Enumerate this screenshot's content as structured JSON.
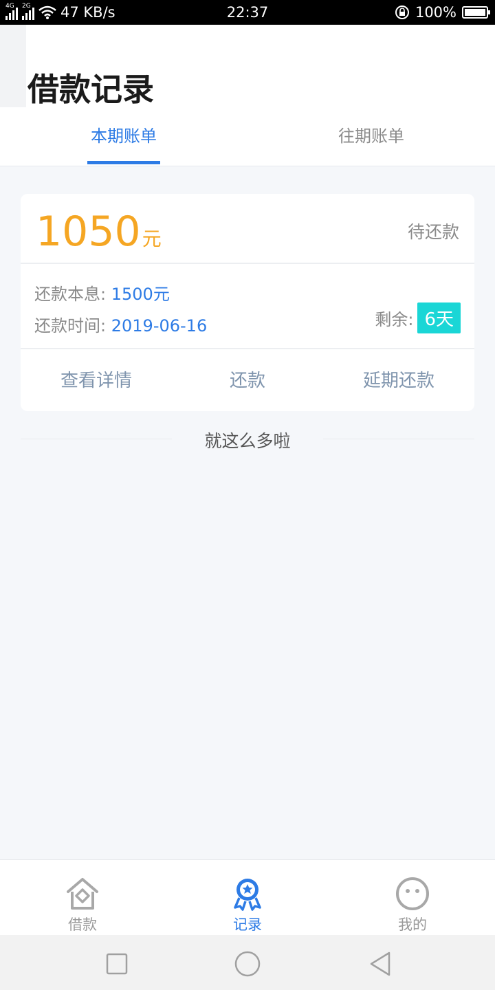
{
  "status_bar": {
    "net1": "4G",
    "net2": "2G",
    "speed": "47 KB/s",
    "time": "22:37",
    "battery": "100%",
    "battery_level": 1.0
  },
  "header": {
    "title": "借款记录",
    "tabs": [
      {
        "label": "本期账单",
        "active": true
      },
      {
        "label": "往期账单",
        "active": false
      }
    ]
  },
  "bill": {
    "amount": "1050",
    "amount_unit": "元",
    "status": "待还款",
    "principal_label": "还款本息:",
    "principal_value": "1500元",
    "date_label": "还款时间:",
    "date_value": "2019-06-16",
    "remain_label": "剩余:",
    "remain_value": "6天",
    "actions": {
      "details": "查看详情",
      "repay": "还款",
      "extend": "延期还款"
    }
  },
  "end_hint": "就这么多啦",
  "bottom_nav": {
    "items": [
      {
        "label": "借款",
        "icon": "house-icon",
        "active": false
      },
      {
        "label": "记录",
        "icon": "ribbon-medal-icon",
        "active": true
      },
      {
        "label": "我的",
        "icon": "face-icon",
        "active": false
      }
    ]
  },
  "colors": {
    "accent": "#2d7be5",
    "amount": "#f5a623",
    "badge": "#1ad6d6",
    "action_text": "#7f94ad",
    "inactive": "#9a9a9a"
  }
}
